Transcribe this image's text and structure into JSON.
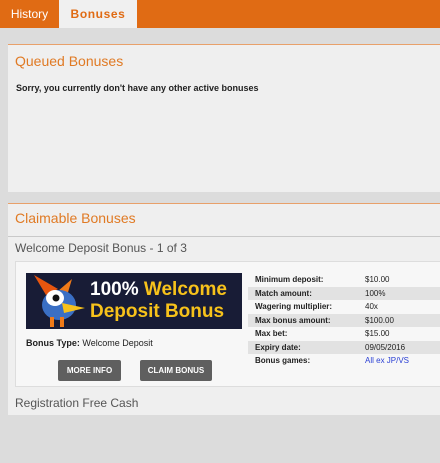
{
  "tabs": {
    "history": "History",
    "bonuses": "Bonuses"
  },
  "queued": {
    "title": "Queued Bonuses",
    "message": "Sorry, you currently don't have any other active bonuses"
  },
  "claimable": {
    "title": "Claimable Bonuses",
    "bonus_heading": "Welcome Deposit Bonus - 1 of 3",
    "banner": {
      "line1_white": "100%",
      "line1_yellow": "Welcome",
      "line2": "Deposit Bonus"
    },
    "bonus_type_label": "Bonus Type:",
    "bonus_type_value": "Welcome Deposit",
    "more_info_label": "MORE INFO",
    "claim_label": "CLAIM BONUS",
    "details": [
      {
        "label": "Minimum deposit:",
        "value": "$10.00"
      },
      {
        "label": "Match amount:",
        "value": "100%"
      },
      {
        "label": "Wagering multiplier:",
        "value": "40x"
      },
      {
        "label": "Max bonus amount:",
        "value": "$100.00"
      },
      {
        "label": "Max bet:",
        "value": "$15.00"
      },
      {
        "label": "Expiry date:",
        "value": "09/05/2016"
      },
      {
        "label": "Bonus games:",
        "value": "All ex JP/VS"
      }
    ],
    "next_bonus": "Registration Free Cash"
  },
  "colors": {
    "accent": "#e06b14",
    "section_title": "#e07a24",
    "banner_bg": "#181c36",
    "banner_yellow": "#f7c21b",
    "link": "#2a3fd4"
  }
}
